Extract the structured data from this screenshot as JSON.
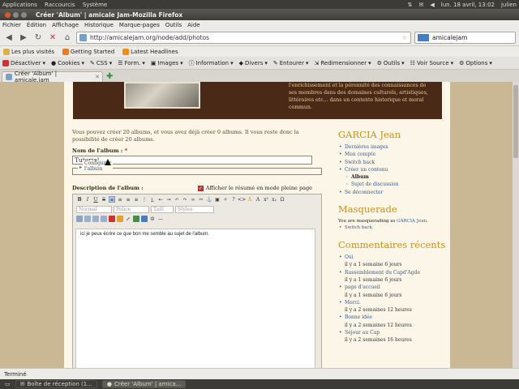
{
  "system": {
    "menus": [
      "Applications",
      "Raccourcis",
      "Système"
    ],
    "datetime": "lun. 18 avril, 13:02",
    "user": "julien"
  },
  "window": {
    "title": "Créer 'Album' | amicale Jam-Mozilla Firefox"
  },
  "menubar": [
    "Fichier",
    "Édition",
    "Affichage",
    "Historique",
    "Marque-pages",
    "Outils",
    "Aide"
  ],
  "nav": {
    "url": "http://amicalejam.org/node/add/photos",
    "search_value": "amicalejam"
  },
  "bookmarks": [
    "Les plus visités",
    "Getting Started",
    "Latest Headlines"
  ],
  "webdev": [
    "Désactiver",
    "Cookies",
    "CSS",
    "Form.",
    "Images",
    "Information",
    "Divers",
    "Entourer",
    "Redimensionner",
    "Outils",
    "Voir Source",
    "Options"
  ],
  "tab": {
    "label": "Créer 'Album' | amicale.jam"
  },
  "banner": {
    "text": "l'enrichissement et la pérennité des connaissances de ses membres dans des domaines culturels, artistiques, littéraires etc... dans un contexte historique et moral commun."
  },
  "form": {
    "intro": "Vous pouvez créer 20 albums, et vous avez déjà créer 0 albums. Il vous reste donc la possibilité de créer 20 albums.",
    "title_label": "Nom de l'album :",
    "required": "*",
    "title_value": "Tutorial",
    "fieldset": "Configurer l'album",
    "desc_label": "Description de l'album :",
    "summary_label": "Afficher le résumé en mode pleine page",
    "editor_text": "ici je peux écrire ce que bon me semble au sujet de l'album.",
    "format_options": {
      "format": "Normal",
      "font": "Police",
      "size": "Taill",
      "styles": "Styles"
    }
  },
  "sidebar": {
    "user_heading": "GARCIA Jean",
    "user_links": [
      "Dernières images",
      "Mon compte",
      "Switch back",
      "Créer un contenu"
    ],
    "sub_links": [
      "Album",
      "Sujet de discussion"
    ],
    "logout": "Se déconnecter",
    "masq_heading": "Masquerade",
    "masq_text_prefix": "You are masquerading as",
    "masq_user": "GARCIA Jean",
    "masq_link": "Switch back",
    "comments_heading": "Commentaires récents",
    "comments": [
      {
        "title": "Oui",
        "time": "il y a 1 semaine 6 jours"
      },
      {
        "title": "Rassemblement du Capd'Agde",
        "time": "il y a 1 semaine 6 jours"
      },
      {
        "title": "page d'accueil",
        "time": "il y a 1 semaine 6 jours"
      },
      {
        "title": "Merci.",
        "time": "il y a 2 semaines 12 heures"
      },
      {
        "title": "Bonne idée",
        "time": "il y a 2 semaines 12 heures"
      },
      {
        "title": "Séjour au Cap",
        "time": "il y a 2 semaines 16 heures"
      }
    ]
  },
  "status": "Terminé",
  "taskbar": [
    "Boîte de réception (1...",
    "Créer 'Album' | amica..."
  ]
}
